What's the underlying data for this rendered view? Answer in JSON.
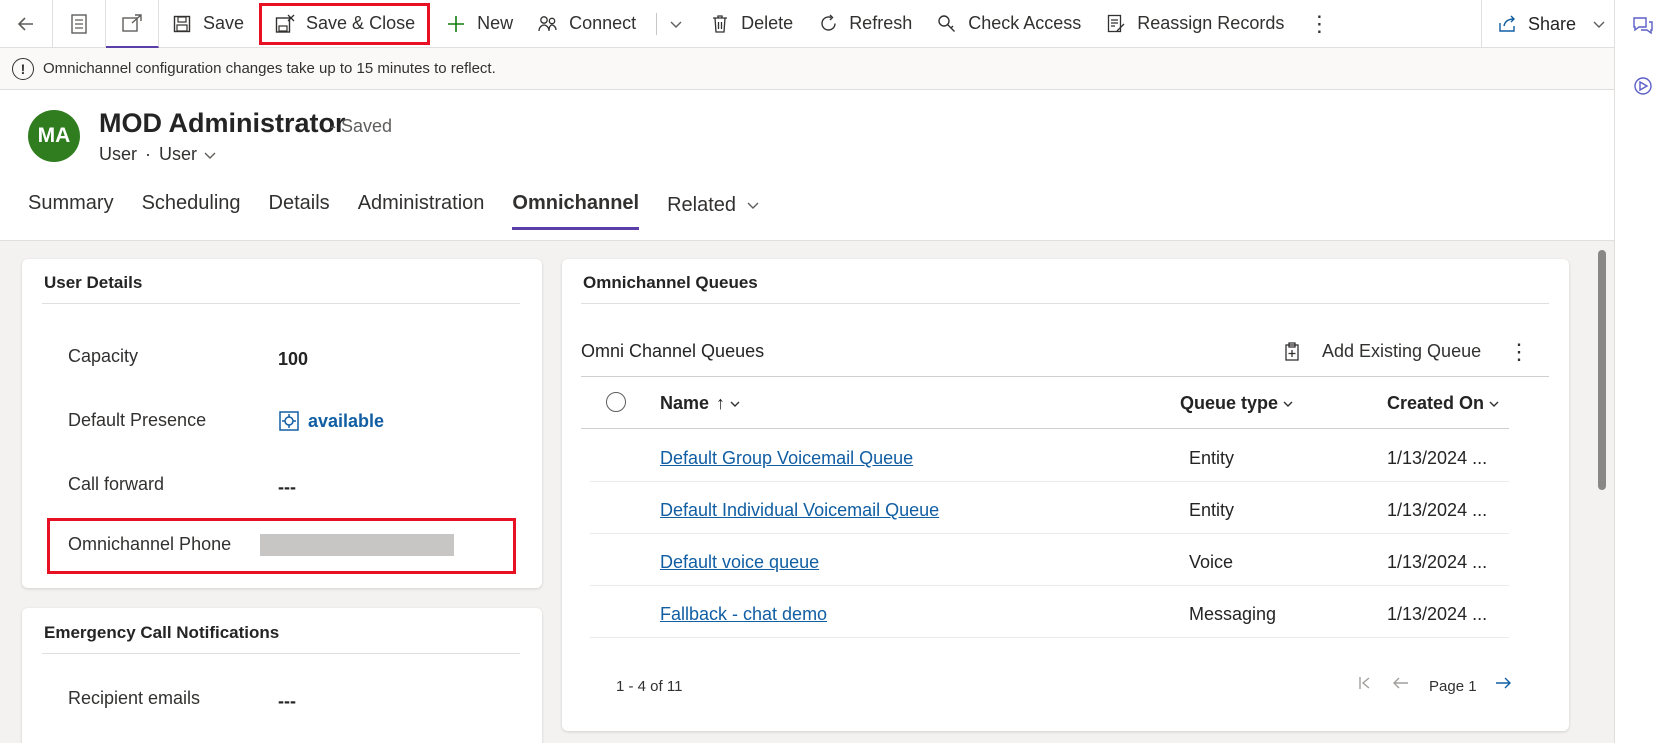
{
  "commandbar": {
    "save": "Save",
    "save_close": "Save & Close",
    "new": "New",
    "connect": "Connect",
    "delete": "Delete",
    "refresh": "Refresh",
    "check_access": "Check Access",
    "reassign": "Reassign Records",
    "share": "Share"
  },
  "notification": {
    "text": "Omnichannel configuration changes take up to 15 minutes to reflect."
  },
  "record": {
    "initials": "MA",
    "name": "MOD Administrator",
    "status": "- Saved",
    "entity": "User",
    "form": "User"
  },
  "tabs": [
    {
      "label": "Summary"
    },
    {
      "label": "Scheduling"
    },
    {
      "label": "Details"
    },
    {
      "label": "Administration"
    },
    {
      "label": "Omnichannel"
    },
    {
      "label": "Related"
    }
  ],
  "user_details": {
    "title": "User Details",
    "capacity_label": "Capacity",
    "capacity_value": "100",
    "presence_label": "Default Presence",
    "presence_value": "available",
    "call_forward_label": "Call forward",
    "call_forward_value": "---",
    "phone_label": "Omnichannel Phone"
  },
  "emergency": {
    "title": "Emergency Call Notifications",
    "recipient_label": "Recipient emails",
    "recipient_value": "---"
  },
  "queues": {
    "section_title": "Omnichannel Queues",
    "grid_title": "Omni Channel Queues",
    "add_existing": "Add Existing Queue",
    "columns": {
      "name": "Name",
      "type": "Queue type",
      "created": "Created On"
    },
    "rows": [
      {
        "name": "Default Group Voicemail Queue",
        "type": "Entity",
        "created": "1/13/2024 ..."
      },
      {
        "name": "Default Individual Voicemail Queue",
        "type": "Entity",
        "created": "1/13/2024 ..."
      },
      {
        "name": "Default voice queue",
        "type": "Voice",
        "created": "1/13/2024 ..."
      },
      {
        "name": "Fallback - chat demo",
        "type": "Messaging",
        "created": "1/13/2024 ..."
      }
    ],
    "range": "1 - 4 of 11",
    "page": "Page 1"
  },
  "colors": {
    "accent": "#5b3fa8",
    "highlight": "#e81123",
    "link": "#115ea3",
    "avatar": "#2f7d1f"
  }
}
